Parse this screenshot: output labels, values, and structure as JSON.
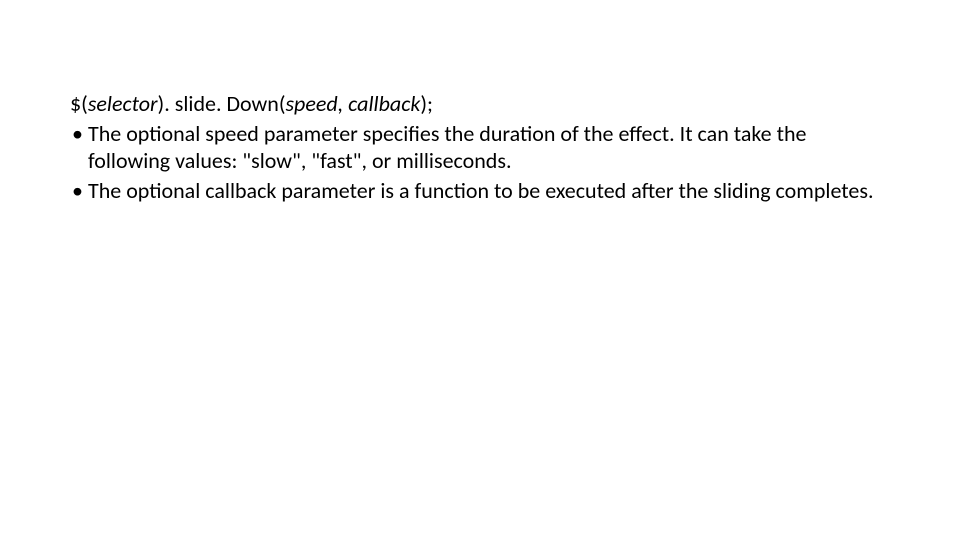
{
  "syntax": {
    "p1": "$(",
    "p2": "selector",
    "p3": "). slide. Down(",
    "p4": "speed, callback",
    "p5": ");"
  },
  "bullets": [
    "The optional speed parameter specifies the duration of the effect. It can take the following values: \"slow\", \"fast\", or milliseconds.",
    "The optional callback parameter is a function to be executed after the sliding completes."
  ],
  "bullet_char": "•"
}
